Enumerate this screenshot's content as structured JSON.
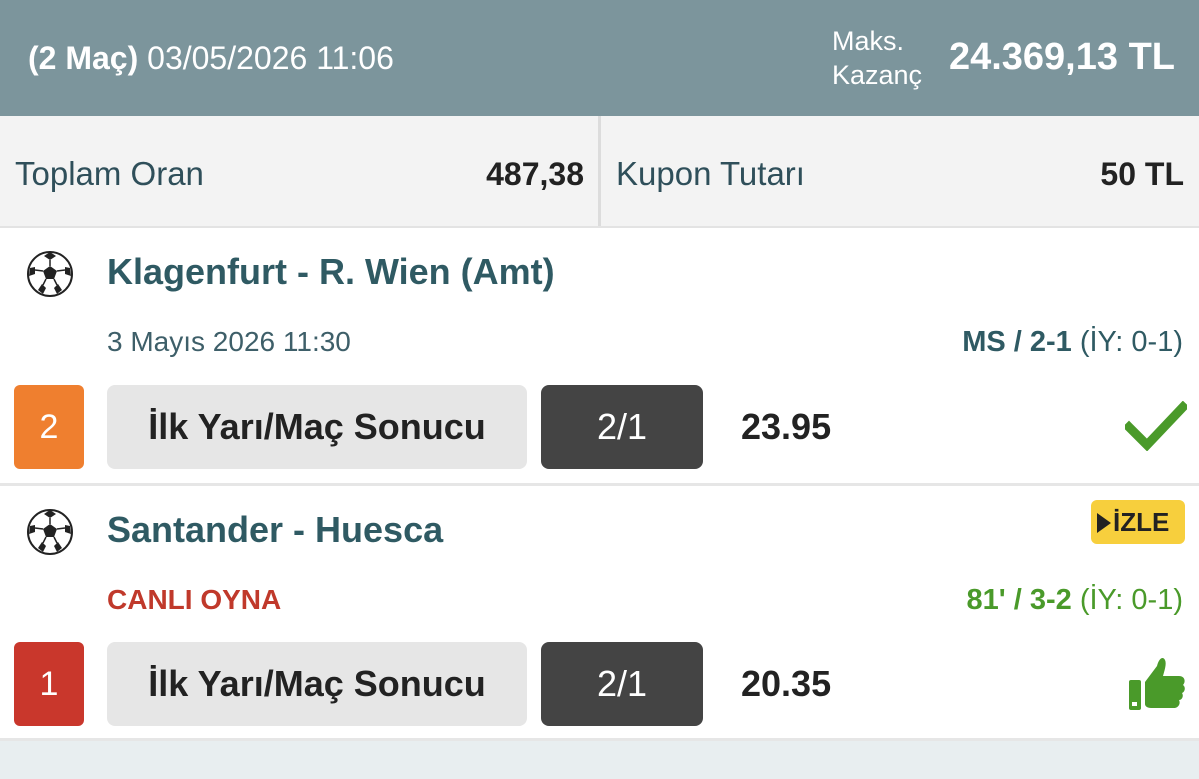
{
  "header": {
    "match_count": "(2 Maç)",
    "datetime": "03/05/2026 11:06",
    "max_win_label": "Maks. Kazanç",
    "max_win_value": "24.369,13 TL"
  },
  "summary": {
    "total_odds_label": "Toplam Oran",
    "total_odds_value": "487,38",
    "coupon_amount_label": "Kupon Tutarı",
    "coupon_amount_value": "50 TL"
  },
  "matches": [
    {
      "teams": "Klagenfurt - R. Wien (Amt)",
      "date": "3 Mayıs 2026 11:30",
      "score_main": "MS / 2-1",
      "score_half": "(İY: 0-1)",
      "number": "2",
      "number_color": "#ef7f2f",
      "market": "İlk Yarı/Maç Sonucu",
      "pick": "2/1",
      "odd": "23.95",
      "status": "check-icon"
    },
    {
      "teams": "Santander - Huesca",
      "live_label": "CANLI OYNA",
      "watch_label": "İZLE",
      "score_main": "81' / 3-2",
      "score_half": "(İY: 0-1)",
      "number": "1",
      "number_color": "#c9372c",
      "market": "İlk Yarı/Maç Sonucu",
      "pick": "2/1",
      "odd": "20.35",
      "status": "thumbs-up-icon"
    }
  ]
}
